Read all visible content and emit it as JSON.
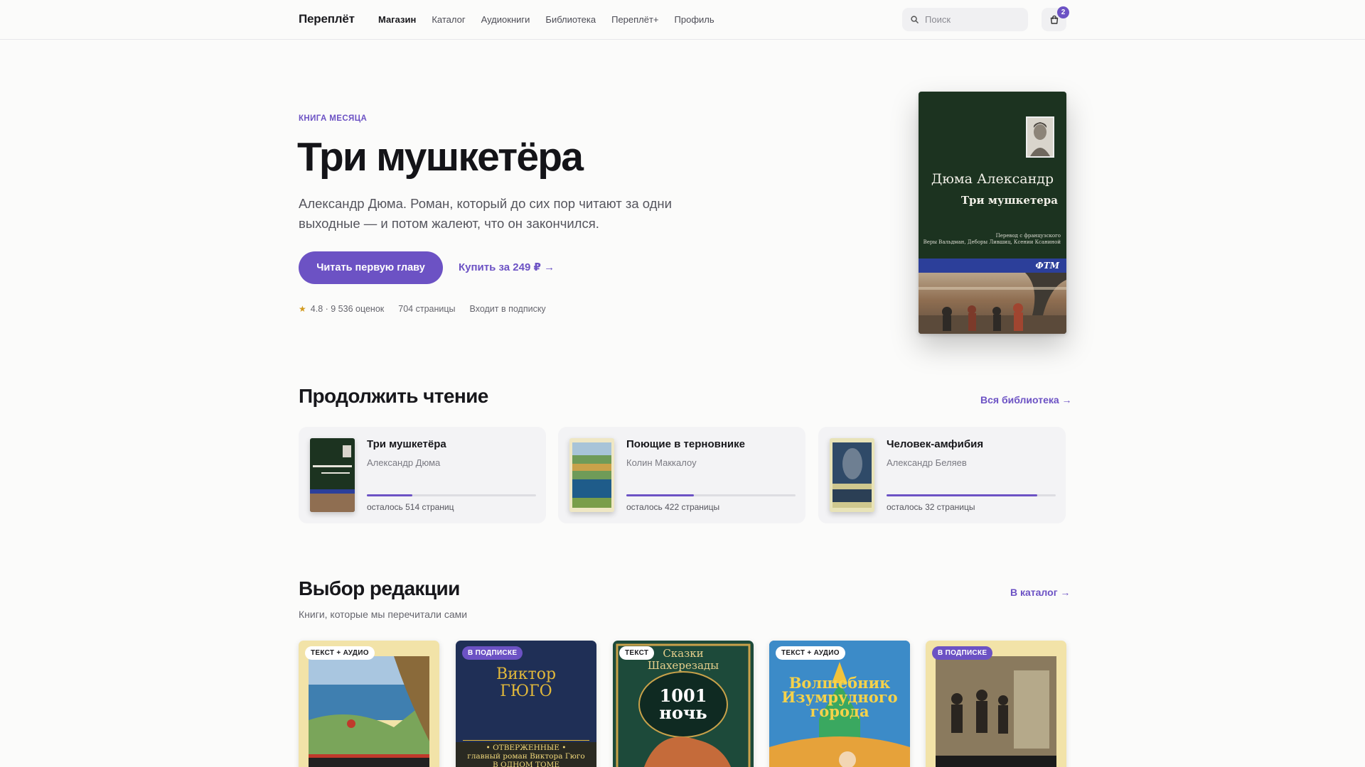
{
  "header": {
    "logo": "Переплёт",
    "nav": [
      "Магазин",
      "Каталог",
      "Аудиокниги",
      "Библиотека",
      "Переплёт+",
      "Профиль"
    ],
    "search_placeholder": "Поиск",
    "cart_count": "2"
  },
  "hero": {
    "eyebrow": "КНИГА МЕСЯЦА",
    "title": "Три мушкетёра",
    "description": "Александр Дюма. Роман, который до сих пор читают за одни выходные — и потом жалеют, что он закончился.",
    "primary_button": "Читать первую главу",
    "buy_link": "Купить за 249 ₽ →",
    "rating": "4.8 · 9 536 оценок",
    "pages": "704 страницы",
    "subscription": "Входит в подписку",
    "cover": {
      "author": "Дюма Александр",
      "title": "Три мушкетера",
      "translation": "Перевод с французского\nВеры Вальдман, Деборы Лившиц, Ксении Ксаниной",
      "publisher": "ФТМ"
    }
  },
  "continue_reading": {
    "title": "Продолжить чтение",
    "link": "Вся библиотека →",
    "items": [
      {
        "title": "Три мушкетёра",
        "author": "Александр Дюма",
        "remaining": "осталось 514 страниц",
        "progress": 0.27
      },
      {
        "title": "Поющие в терновнике",
        "author": "Колин Маккалоу",
        "remaining": "осталось 422 страницы",
        "progress": 0.4
      },
      {
        "title": "Человек-амфибия",
        "author": "Александр Беляев",
        "remaining": "осталось 32 страницы",
        "progress": 0.89
      }
    ]
  },
  "editors_choice": {
    "title": "Выбор редакции",
    "subtitle": "Книги, которые мы перечитали сами",
    "link": "В каталог →",
    "items": [
      {
        "tag": "ТЕКСТ + АУДИО"
      },
      {
        "tag": "В ПОДПИСКЕ",
        "cover_top": "Виктор\nГЮГО",
        "cover_bottom": "• ОТВЕРЖЕННЫЕ •\nглавный роман Виктора Гюго\nВ ОДНОМ ТОМЕ"
      },
      {
        "tag": "ТЕКСТ",
        "cover_top": "Сказки\nШахерезады",
        "cover_mid": "1001\nночь"
      },
      {
        "tag": "ТЕКСТ + АУДИО",
        "cover_top": "Волшебник\nИзумрудного\nгорода"
      },
      {
        "tag": "В ПОДПИСКЕ"
      }
    ]
  },
  "colors": {
    "accent": "#6c52c4",
    "background": "#fbfbfa",
    "card": "#f3f3f5"
  }
}
